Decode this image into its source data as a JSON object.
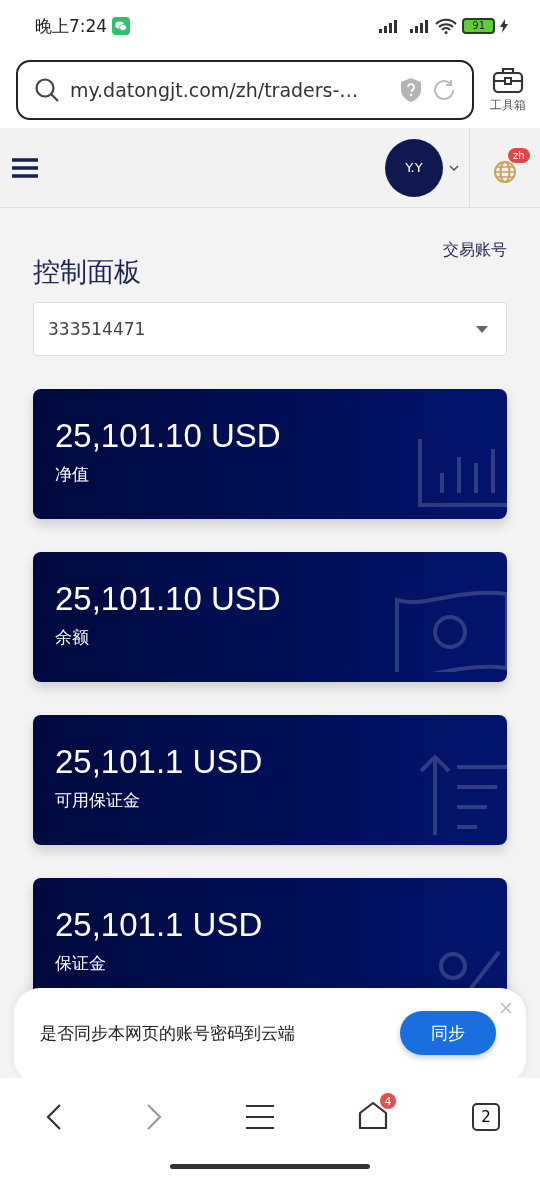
{
  "status_bar": {
    "time": "晚上7:24",
    "battery": "91"
  },
  "address_bar": {
    "url": "my.datongjt.com/zh/traders-…",
    "toolbox_label": "工具箱"
  },
  "site_header": {
    "avatar": "Y.Y",
    "language_badge": "zh"
  },
  "page": {
    "title": "控制面板",
    "account_link": "交易账号",
    "account_select": "333514471"
  },
  "cards": [
    {
      "amount": "25,101.10 USD",
      "label": "净值",
      "kind": "chart"
    },
    {
      "amount": "25,101.10 USD",
      "label": "余额",
      "kind": "cash"
    },
    {
      "amount": "25,101.1 USD",
      "label": "可用保证金",
      "kind": "arrow"
    },
    {
      "amount": "25,101.1 USD",
      "label": "保证金",
      "kind": "percent"
    }
  ],
  "sync_prompt": {
    "text": "是否同步本网页的账号密码到云端",
    "button": "同步"
  },
  "bottom_nav": {
    "forward_disabled": true,
    "home_badge": "4",
    "tabs_count": "2"
  }
}
